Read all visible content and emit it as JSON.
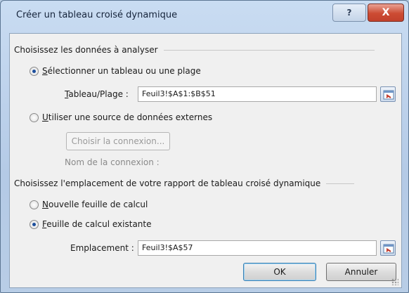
{
  "window": {
    "title": "Créer un tableau croisé dynamique",
    "help_label": "?",
    "close_label": "X"
  },
  "section_data": {
    "header": "Choisissez les données à analyser",
    "option_range": {
      "mnemonic": "S",
      "label_rest": "électionner un tableau ou une plage",
      "checked": true
    },
    "range_field": {
      "label_mnemonic": "T",
      "label_rest": "ableau/Plage :",
      "value": "Feuil3!$A$1:$B$51"
    },
    "option_external": {
      "mnemonic": "U",
      "label_rest": "tiliser une source de données externes",
      "checked": false
    },
    "choose_connection_label": "Choisir la connexion...",
    "connection_name_label": "Nom de la connexion :"
  },
  "section_location": {
    "header": "Choisissez l'emplacement de votre rapport de tableau croisé dynamique",
    "option_new_sheet": {
      "mnemonic": "N",
      "label_rest": "ouvelle feuille de calcul",
      "checked": false
    },
    "option_existing_sheet": {
      "mnemonic": "F",
      "label_rest": "euille de calcul existante",
      "checked": true
    },
    "location_field": {
      "label": "Emplacement :",
      "value": "Feuil3!$A$57"
    }
  },
  "buttons": {
    "ok_label": "OK",
    "cancel_label": "Annuler"
  },
  "icons": {
    "range_selector": "collapse-dialog-icon",
    "help": "help-icon",
    "close": "close-icon"
  }
}
